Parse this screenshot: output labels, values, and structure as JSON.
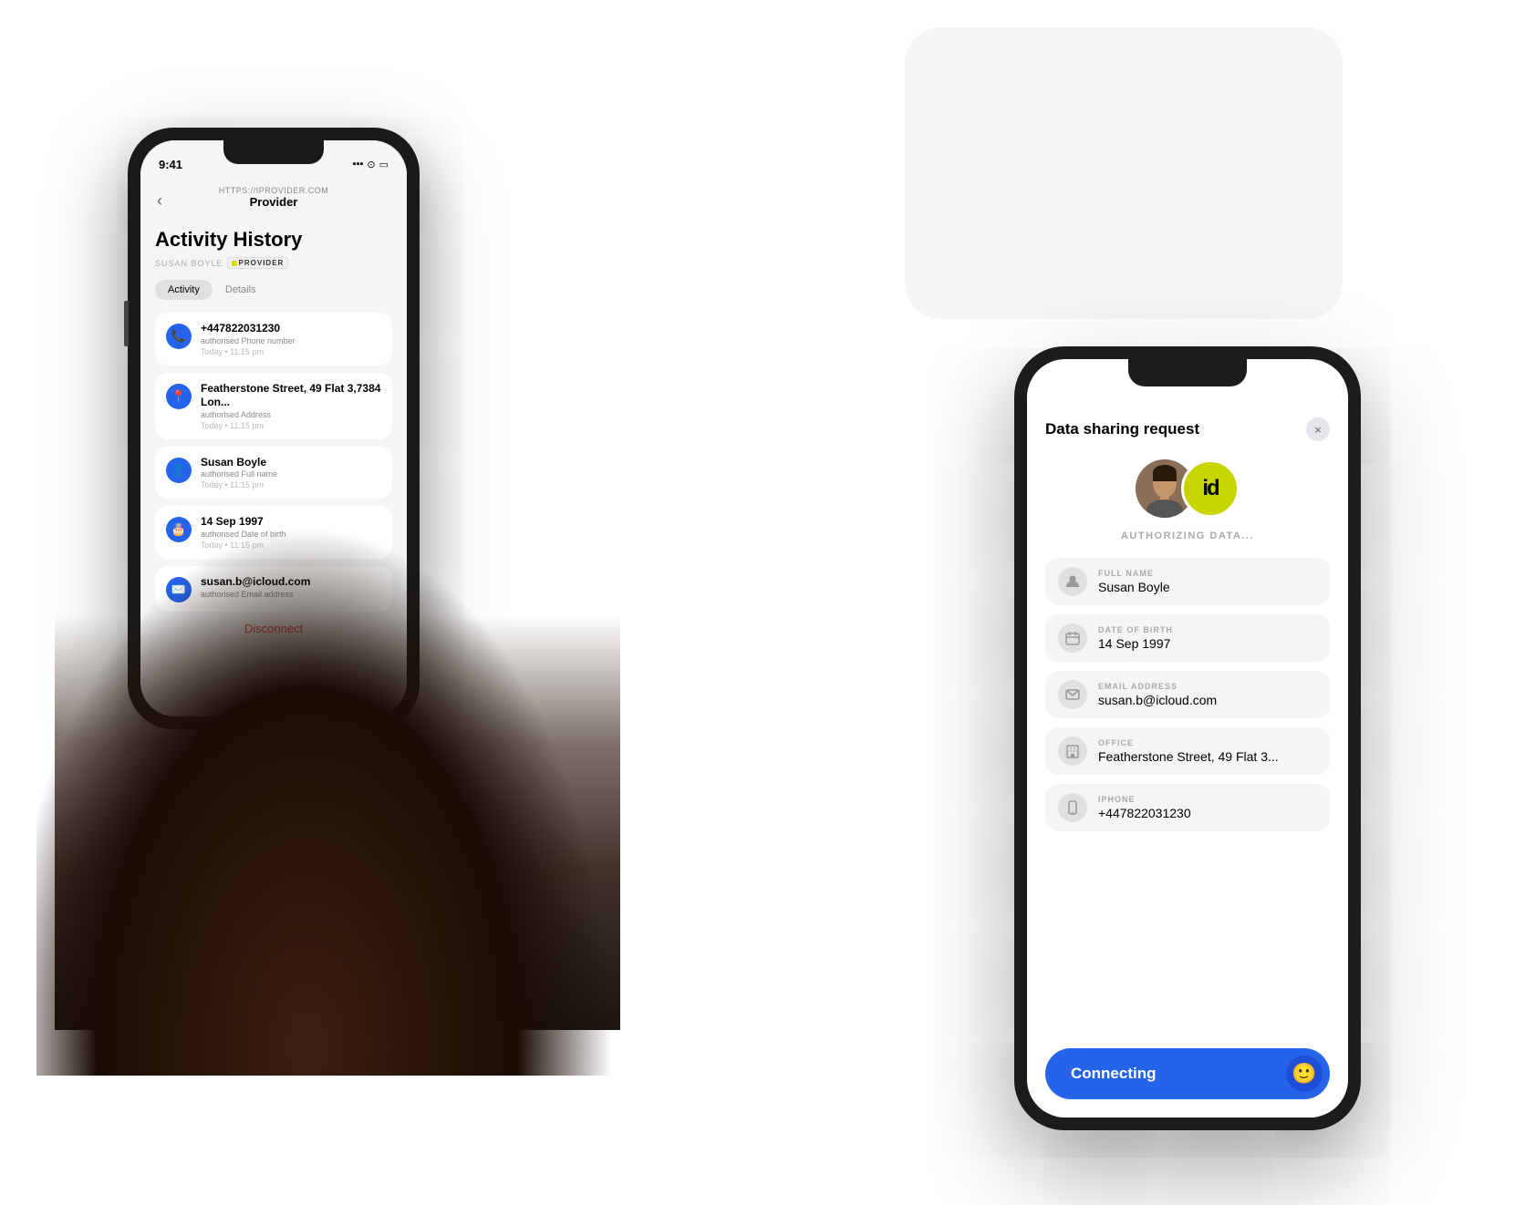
{
  "background_card": {
    "visible": true
  },
  "left_phone": {
    "status_bar": {
      "time": "9:41",
      "signal_icon": "📶",
      "wifi_icon": "wifi",
      "battery_icon": "battery"
    },
    "url_bar": {
      "url": "HTTPS://IPROVIDER.COM",
      "provider": "Provider"
    },
    "back_button": "‹",
    "screen": {
      "title": "Activity History",
      "subtitle": "SUSAN BOYLE",
      "provider_label": "PROVIDER",
      "tabs": [
        {
          "label": "Activity",
          "active": true
        },
        {
          "label": "Details",
          "active": false
        }
      ],
      "items": [
        {
          "value": "+447822031230",
          "label": "authorised Phone number",
          "time": "Today • 11:15 pm",
          "icon": "phone"
        },
        {
          "value": "Featherstone Street, 49 Flat 3,7384 Lon...",
          "label": "authorised Address",
          "time": "Today • 11:15 pm",
          "icon": "location"
        },
        {
          "value": "Susan Boyle",
          "label": "authorised Full name",
          "time": "Today • 11:15 pm",
          "icon": "person"
        },
        {
          "value": "14 Sep 1997",
          "label": "authorised Date of birth",
          "time": "Today • 11:15 pm",
          "icon": "cake"
        },
        {
          "value": "susan.b@icloud.com",
          "label": "authorised Email address",
          "time": "",
          "icon": "email"
        }
      ],
      "disconnect_label": "Disconnect"
    }
  },
  "right_phone": {
    "modal": {
      "title": "Data sharing request",
      "close_button": "×",
      "authorizing_text": "AUTHORIZING DATA...",
      "fields": [
        {
          "label": "FULL NAME",
          "value": "Susan Boyle",
          "icon": "person"
        },
        {
          "label": "DATE OF BIRTH",
          "value": "14 Sep 1997",
          "icon": "calendar"
        },
        {
          "label": "EMAIL ADDRESS",
          "value": "susan.b@icloud.com",
          "icon": "email"
        },
        {
          "label": "OFFICE",
          "value": "Featherstone Street, 49 Flat 3...",
          "icon": "building"
        },
        {
          "label": "IPHONE",
          "value": "+447822031230",
          "icon": "phone"
        }
      ],
      "connect_button": {
        "label": "Connecting",
        "color": "#2563eb"
      }
    }
  }
}
